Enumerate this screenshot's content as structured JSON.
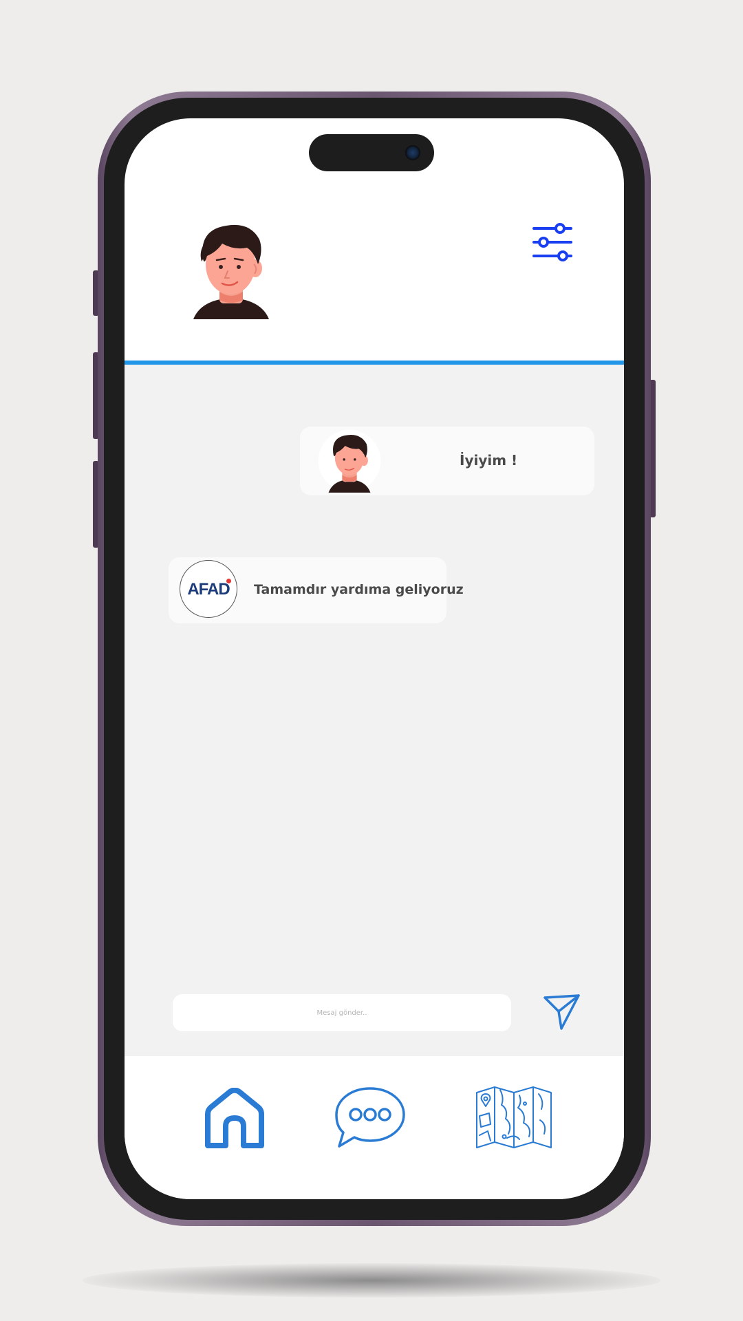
{
  "screen": {
    "accent_color": "#2196e8",
    "icon_color": "#2a7bd4",
    "filter_icon_color": "#1a3ff0"
  },
  "header": {
    "avatar_icon": "user-avatar-icon",
    "filter_icon": "sliders-icon"
  },
  "messages": [
    {
      "sender": "user",
      "avatar_icon": "user-avatar-icon",
      "text": "İyiyim !"
    },
    {
      "sender": "afad",
      "logo_text": "AFAD",
      "text": "Tamamdır yardıma geliyoruz"
    }
  ],
  "composer": {
    "placeholder": "Mesaj gönder..",
    "value": "",
    "send_icon": "send-icon"
  },
  "nav": {
    "items": [
      {
        "icon": "home-icon"
      },
      {
        "icon": "chat-bubble-icon"
      },
      {
        "icon": "map-icon"
      }
    ]
  }
}
